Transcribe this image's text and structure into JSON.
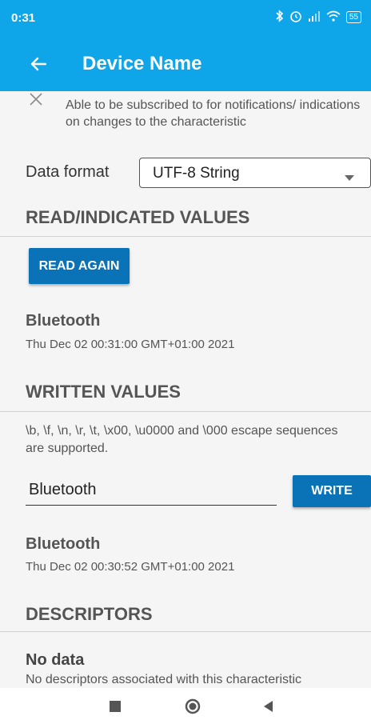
{
  "status_bar": {
    "time": "0:31",
    "battery": "55"
  },
  "app_bar": {
    "title": "Device Name"
  },
  "property": {
    "description": "Able to be subscribed to for notifications/ indications on changes to the characteristic"
  },
  "data_format": {
    "label": "Data format",
    "selected": "UTF-8 String"
  },
  "read_section": {
    "title": "READ/INDICATED VALUES",
    "button_label": "READ AGAIN",
    "value": "Bluetooth",
    "timestamp": "Thu Dec 02 00:31:00 GMT+01:00 2021"
  },
  "written_section": {
    "title": "WRITTEN VALUES",
    "hint": "\\b, \\f, \\n, \\r, \\t, \\x00, \\u0000 and \\000 escape sequences are supported.",
    "input_value": "Bluetooth",
    "button_label": "WRITE",
    "value": "Bluetooth",
    "timestamp": "Thu Dec 02 00:30:52 GMT+01:00 2021"
  },
  "descriptors_section": {
    "title": "DESCRIPTORS",
    "empty_title": "No data",
    "empty_desc": "No descriptors associated with this characteristic"
  },
  "colors": {
    "primary": "#0ea5e9",
    "button": "#0a72b6"
  },
  "icons": [
    "back-arrow-icon",
    "close-icon",
    "dropdown-arrow-icon",
    "bluetooth-icon",
    "alarm-icon",
    "signal-icon",
    "wifi-icon",
    "battery-icon",
    "recents-icon",
    "home-icon",
    "back-icon"
  ]
}
